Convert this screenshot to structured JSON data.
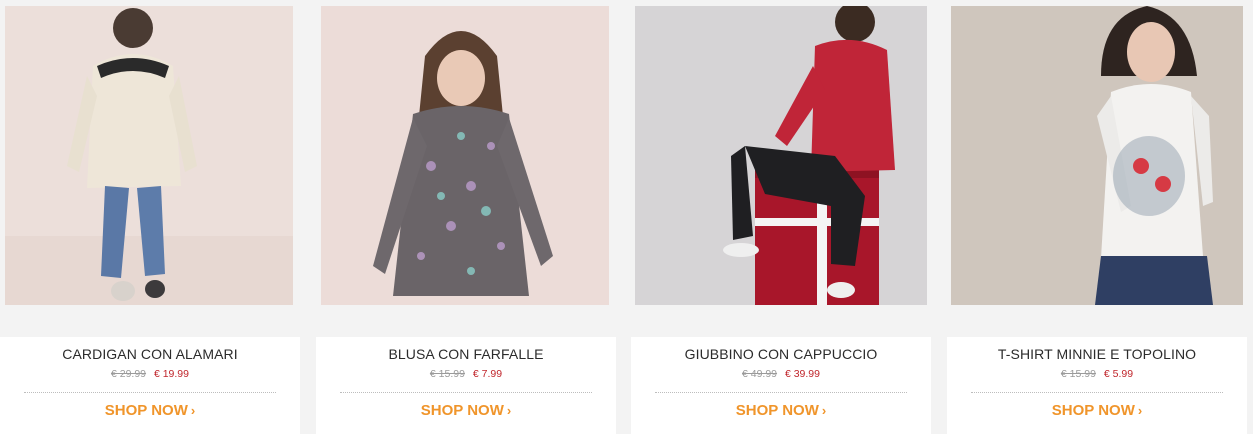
{
  "products": [
    {
      "name": "CARDIGAN CON ALAMARI",
      "old_price": "€ 29.99",
      "new_price": "€ 19.99",
      "cta": "SHOP NOW",
      "cta_icon": "chevron-right-icon"
    },
    {
      "name": "BLUSA CON FARFALLE",
      "old_price": "€ 15.99",
      "new_price": "€ 7.99",
      "cta": "SHOP NOW",
      "cta_icon": "chevron-right-icon"
    },
    {
      "name": "GIUBBINO CON CAPPUCCIO",
      "old_price": "€ 49.99",
      "new_price": "€ 39.99",
      "cta": "SHOP NOW",
      "cta_icon": "chevron-right-icon"
    },
    {
      "name": "T-SHIRT MINNIE E TOPOLINO",
      "old_price": "€ 15.99",
      "new_price": "€ 5.99",
      "cta": "SHOP NOW",
      "cta_icon": "chevron-right-icon"
    }
  ],
  "colors": {
    "page_bg": "#f3f3f3",
    "card_bg": "#ffffff",
    "sale_price": "#c0262c",
    "cta": "#f0952b"
  }
}
